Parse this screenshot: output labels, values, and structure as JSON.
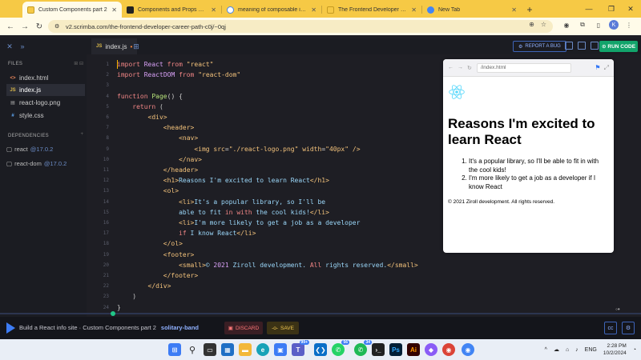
{
  "browser": {
    "tabs": [
      {
        "label": "Custom Components part 2",
        "active": true,
        "icon_color": "#f6c945"
      },
      {
        "label": "Components and Props – React",
        "active": false,
        "icon_color": "#222222"
      },
      {
        "label": "meaning of composable in react",
        "active": false,
        "icon_color": "#4285f4"
      },
      {
        "label": "The Frontend Developer Career",
        "active": false,
        "icon_color": "#f6c945"
      },
      {
        "label": "New Tab",
        "active": false,
        "icon_color": "#4285f4"
      }
    ],
    "url": "v2.scrimba.com/the-frontend-developer-career-path-c0j/~0qj",
    "avatar_letter": "K"
  },
  "app": {
    "open_file": "index.js",
    "report_bug_label": "REPORT A BUG",
    "run_label": "RUN CODE",
    "sidebar": {
      "files_heading": "FILES",
      "files": [
        {
          "name": "index.html",
          "type": "html",
          "active": false
        },
        {
          "name": "index.js",
          "type": "js",
          "active": true
        },
        {
          "name": "react-logo.png",
          "type": "img",
          "active": false
        },
        {
          "name": "style.css",
          "type": "css",
          "active": false
        }
      ],
      "deps_heading": "DEPENDENCIES",
      "dependencies": [
        {
          "name": "react",
          "version": "@17.0.2"
        },
        {
          "name": "react-dom",
          "version": "@17.0.2"
        }
      ]
    },
    "code_lines": [
      "<span class=\"kw\">import</span> <span class=\"id\">React</span> <span class=\"kw\">from</span> <span class=\"str\">\"react\"</span>",
      "<span class=\"kw\">import</span> <span class=\"id\">ReactDOM</span> <span class=\"kw\">from</span> <span class=\"str\">\"react-dom\"</span>",
      "",
      "<span class=\"kw\">function</span> <span class=\"fn\">Page</span><span class=\"brk\">() {</span>",
      "    <span class=\"kw\">return</span> <span class=\"brk\">(</span>",
      "        <span class=\"tag\">&lt;div&gt;</span>",
      "            <span class=\"tag\">&lt;header&gt;</span>",
      "                <span class=\"tag\">&lt;nav&gt;</span>",
      "                    <span class=\"tag\">&lt;img</span> <span class=\"attr\">src</span>=<span class=\"str\">\"./react-logo.png\"</span> <span class=\"attr\">width</span>=<span class=\"str\">\"40px\"</span> <span class=\"tag\">/&gt;</span>",
      "                <span class=\"tag\">&lt;/nav&gt;</span>",
      "            <span class=\"tag\">&lt;/header&gt;</span>",
      "            <span class=\"tag\">&lt;h1&gt;</span><span class=\"txt\">Reasons I'm excited to learn React</span><span class=\"tag\">&lt;/h1&gt;</span>",
      "            <span class=\"tag\">&lt;ol&gt;</span>",
      "                <span class=\"tag\">&lt;li&gt;</span><span class=\"txt\">It's a popular library, so I'll be</span>",
      "                <span class=\"txt\">able to fit </span><span class=\"kw\">in</span> <span class=\"kw\">with</span> <span class=\"txt\">the cool kids!</span><span class=\"tag\">&lt;/li&gt;</span>",
      "                <span class=\"tag\">&lt;li&gt;</span><span class=\"txt\">I'm more likely to get a job as a developer</span>",
      "                <span class=\"kw\">if</span> <span class=\"txt\">I know React</span><span class=\"tag\">&lt;/li&gt;</span>",
      "            <span class=\"tag\">&lt;/ol&gt;</span>",
      "            <span class=\"tag\">&lt;footer&gt;</span>",
      "                <span class=\"tag\">&lt;small&gt;</span><span class=\"txt\">© </span><span class=\"id\">2021</span> <span class=\"txt\">Ziroll development. </span><span class=\"kw\">All</span> <span class=\"txt\">rights reserved.</span><span class=\"tag\">&lt;/small&gt;</span>",
      "            <span class=\"tag\">&lt;/footer&gt;</span>",
      "        <span class=\"tag\">&lt;/div&gt;</span>",
      "    <span class=\"brk\">)</span>",
      "<span class=\"brk\">}</span>"
    ],
    "preview": {
      "url": "/index.html",
      "heading": "Reasons I'm excited to learn React",
      "list": [
        "It's a popular library, so I'll be able to fit in with the cool kids!",
        "I'm more likely to get a job as a developer if I know React"
      ],
      "footer": "© 2021 Ziroll development. All rights reserved."
    },
    "bottom": {
      "breadcrumb": "Build a React info site · Custom Components part 2",
      "branch": "solitary-band",
      "discard_label": "DISCARD",
      "save_label": "SAVE"
    }
  },
  "taskbar": {
    "badges": [
      "99+",
      "56",
      "34"
    ],
    "lang": "ENG",
    "time": "2:28 PM",
    "date": "10/2/2024"
  },
  "colors": {
    "browser_accent": "#f6c945",
    "run_button": "#12a46b",
    "editor_bg": "#1e1e24",
    "react_blue": "#61dafb"
  }
}
